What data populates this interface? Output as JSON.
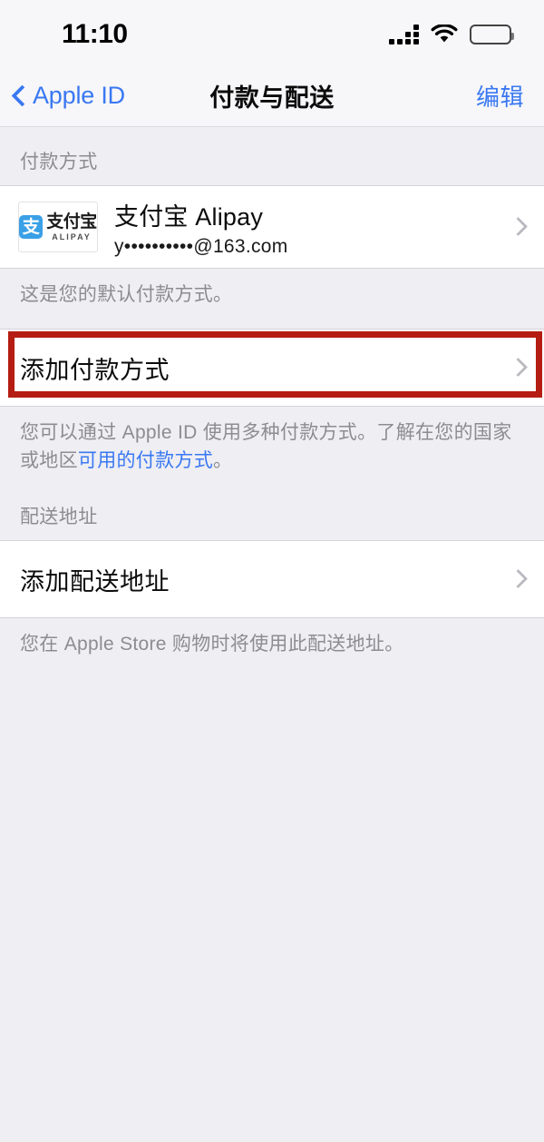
{
  "status_bar": {
    "time": "11:10",
    "cellular_icon": "cellular-signal-icon",
    "wifi_icon": "wifi-icon",
    "battery_icon": "battery-full-icon"
  },
  "nav": {
    "back_label": "Apple ID",
    "back_icon": "chevron-left-icon",
    "title": "付款与配送",
    "edit_label": "编辑"
  },
  "payment_section": {
    "header": "付款方式",
    "method": {
      "logo_cn": "支付宝",
      "logo_en": "ALIPAY",
      "logo_glyph": "支",
      "title": "支付宝 Alipay",
      "subtitle": "y••••••••••@163.com",
      "arrow_icon": "chevron-right-icon"
    },
    "default_note": "这是您的默认付款方式。",
    "add_label": "添加付款方式",
    "add_arrow_icon": "chevron-right-icon",
    "footer_text_before": "您可以通过 Apple ID 使用多种付款方式。了解在您的国家或地区",
    "footer_link": "可用的付款方式",
    "footer_text_after": "。"
  },
  "shipping_section": {
    "header": "配送地址",
    "add_label": "添加配送地址",
    "add_arrow_icon": "chevron-right-icon",
    "footer_text": "您在 Apple Store 购物时将使用此配送地址。"
  },
  "colors": {
    "accent_blue": "#3a78f2",
    "highlight_red": "#b51c12",
    "page_background": "#eeeef3",
    "cell_background": "#ffffff",
    "secondary_text": "#8c8c92",
    "alipay_blue": "#3aa0e6"
  }
}
